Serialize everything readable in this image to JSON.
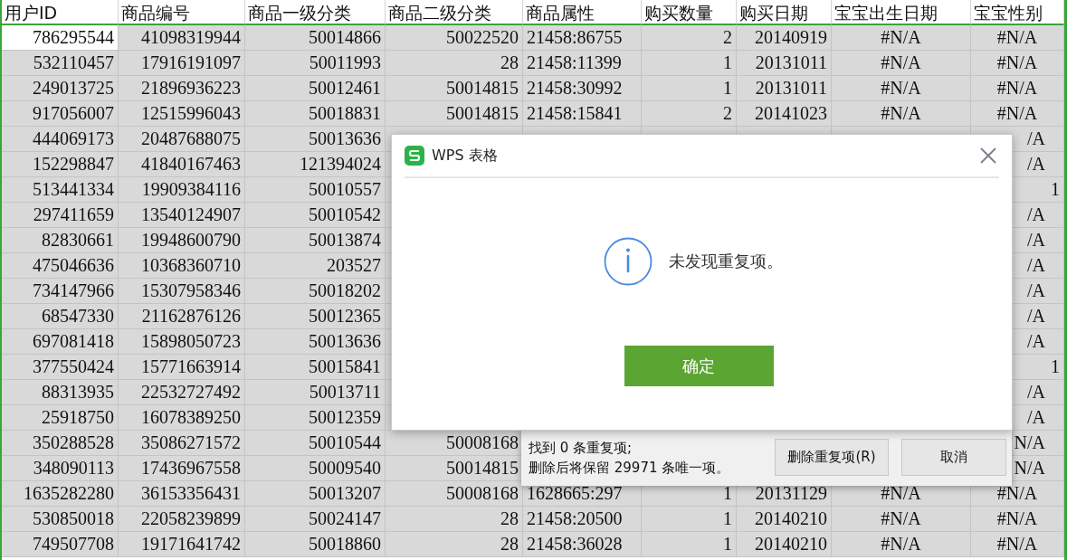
{
  "sheet": {
    "columns": [
      "用户ID",
      "商品编号",
      "商品一级分类",
      "商品二级分类",
      "商品属性",
      "购买数量",
      "购买日期",
      "宝宝出生日期",
      "宝宝性别"
    ],
    "rows": [
      {
        "active": true,
        "cells": [
          "786295544",
          "41098319944",
          "50014866",
          "50022520",
          "21458:86755",
          "2",
          "20140919",
          "#N/A",
          "#N/A"
        ]
      },
      {
        "active": false,
        "cells": [
          "532110457",
          "17916191097",
          "50011993",
          "28",
          "21458:11399",
          "1",
          "20131011",
          "#N/A",
          "#N/A"
        ]
      },
      {
        "active": false,
        "cells": [
          "249013725",
          "21896936223",
          "50012461",
          "50014815",
          "21458:30992",
          "1",
          "20131011",
          "#N/A",
          "#N/A"
        ]
      },
      {
        "active": false,
        "cells": [
          "917056007",
          "12515996043",
          "50018831",
          "50014815",
          "21458:15841",
          "2",
          "20141023",
          "#N/A",
          "#N/A"
        ]
      },
      {
        "active": false,
        "cells": [
          "444069173",
          "20487688075",
          "50013636"
        ],
        "edge_cell": {
          "text": "/A",
          "kind": "clipped"
        }
      },
      {
        "active": false,
        "cells": [
          "152298847",
          "41840167463",
          "121394024"
        ],
        "edge_cell": {
          "text": "/A",
          "kind": "clipped"
        }
      },
      {
        "active": false,
        "cells": [
          "513441334",
          "19909384116",
          "50010557"
        ],
        "edge_cell": {
          "text": "1",
          "kind": "number"
        }
      },
      {
        "active": false,
        "cells": [
          "297411659",
          "13540124907",
          "50010542"
        ],
        "edge_cell": {
          "text": "/A",
          "kind": "clipped"
        }
      },
      {
        "active": false,
        "cells": [
          "82830661",
          "19948600790",
          "50013874"
        ],
        "edge_cell": {
          "text": "/A",
          "kind": "clipped"
        }
      },
      {
        "active": false,
        "cells": [
          "475046636",
          "10368360710",
          "203527"
        ],
        "edge_cell": {
          "text": "/A",
          "kind": "clipped"
        }
      },
      {
        "active": false,
        "cells": [
          "734147966",
          "15307958346",
          "50018202"
        ],
        "edge_cell": {
          "text": "/A",
          "kind": "clipped"
        }
      },
      {
        "active": false,
        "cells": [
          "68547330",
          "21162876126",
          "50012365"
        ],
        "edge_cell": {
          "text": "/A",
          "kind": "clipped"
        }
      },
      {
        "active": false,
        "cells": [
          "697081418",
          "15898050723",
          "50013636"
        ],
        "edge_cell": {
          "text": "/A",
          "kind": "clipped"
        }
      },
      {
        "active": false,
        "cells": [
          "377550424",
          "15771663914",
          "50015841"
        ],
        "edge_cell": {
          "text": "1",
          "kind": "number"
        }
      },
      {
        "active": false,
        "cells": [
          "88313935",
          "22532727492",
          "50013711"
        ],
        "edge_cell": {
          "text": "/A",
          "kind": "clipped"
        }
      },
      {
        "active": false,
        "cells": [
          "25918750",
          "16078389250",
          "50012359"
        ],
        "edge_cell": {
          "text": "/A",
          "kind": "clipped"
        }
      },
      {
        "active": false,
        "cells": [
          "350288528",
          "35086271572",
          "50010544",
          "50008168"
        ],
        "edge_cell": {
          "text": "N/A",
          "kind": "clipped"
        }
      },
      {
        "active": false,
        "cells": [
          "348090113",
          "17436967558",
          "50009540",
          "50014815"
        ],
        "edge_cell": {
          "text": "N/A",
          "kind": "clipped"
        }
      },
      {
        "active": false,
        "cells": [
          "1635282280",
          "36153356431",
          "50013207",
          "50008168",
          "1628665:297",
          "1",
          "20131129",
          "#N/A",
          "#N/A"
        ]
      },
      {
        "active": false,
        "cells": [
          "530850018",
          "22058239899",
          "50024147",
          "28",
          "21458:20500",
          "1",
          "20140210",
          "#N/A",
          "#N/A"
        ]
      },
      {
        "active": false,
        "cells": [
          "749507708",
          "19171641742",
          "50018860",
          "28",
          "21458:36028",
          "1",
          "20140210",
          "#N/A",
          "#N/A"
        ]
      }
    ]
  },
  "duplicates_panel": {
    "lines": [
      "找到 0 条重复项;",
      "删除后将保留 29971 条唯一项。"
    ],
    "buttons": [
      "删除重复项(R)",
      "取消"
    ]
  },
  "dialog": {
    "title": "WPS 表格",
    "message": "未发现重复项。",
    "button": "确定"
  }
}
